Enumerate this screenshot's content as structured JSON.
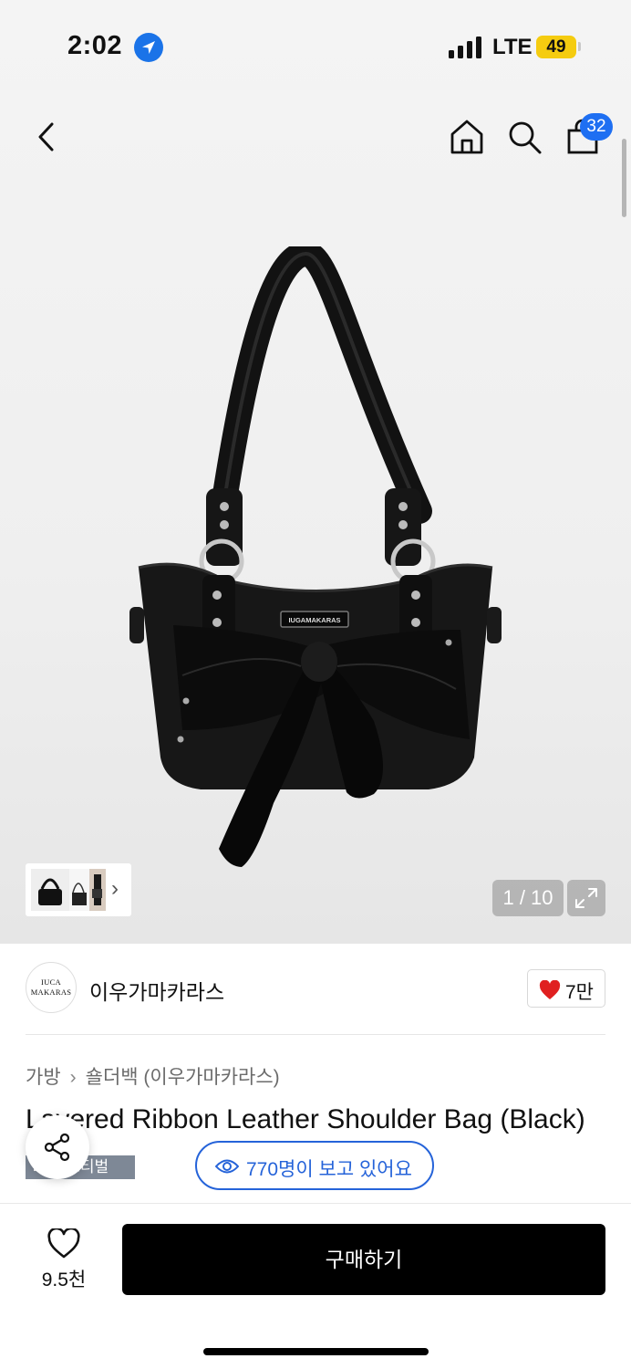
{
  "status_bar": {
    "time": "2:02",
    "network": "LTE",
    "battery": "49"
  },
  "nav": {
    "cart_count": "32"
  },
  "gallery": {
    "counter": "1 / 10",
    "bag_plaque_text": "IUGAMAKARAS"
  },
  "brand": {
    "logo_line1": "IUCA",
    "logo_line2": "MAKARAS",
    "name": "이우가마카라스",
    "likes": "7만"
  },
  "breadcrumb": {
    "category": "가방",
    "subcategory": "숄더백 (이우가마카라스)"
  },
  "product": {
    "title": "Layered Ribbon Leather Shoulder Bag (Black)",
    "tag": "■■페스티벌"
  },
  "viewers": {
    "text": "770명이 보고 있어요"
  },
  "bottom_bar": {
    "wish_count": "9.5천",
    "buy_label": "구매하기"
  },
  "colors": {
    "accent_blue": "#2563d9",
    "badge_blue": "#1e6ff2",
    "heart_red": "#e02020",
    "buy_black": "#000000"
  },
  "icons": [
    "location-arrow-icon",
    "signal-icon",
    "back-icon",
    "home-icon",
    "search-icon",
    "shopping-bag-icon",
    "expand-icon",
    "heart-icon",
    "share-icon",
    "eye-icon",
    "chevron-right-icon"
  ]
}
